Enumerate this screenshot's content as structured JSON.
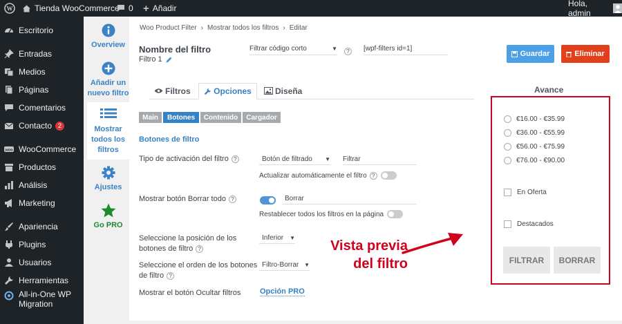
{
  "admin_bar": {
    "site_name": "Tienda WooCommerce",
    "comments_count": "0",
    "new_label": "Añadir",
    "greeting": "Hola, admin"
  },
  "sidebar": {
    "items": [
      {
        "label": "Escritorio",
        "icon": "dashboard-icon"
      },
      {
        "label": "Entradas",
        "icon": "pin-icon"
      },
      {
        "label": "Medios",
        "icon": "media-icon"
      },
      {
        "label": "Páginas",
        "icon": "pages-icon"
      },
      {
        "label": "Comentarios",
        "icon": "comment-icon"
      },
      {
        "label": "Contacto",
        "icon": "mail-icon",
        "badge": "2"
      },
      {
        "label": "WooCommerce",
        "icon": "woo-icon"
      },
      {
        "label": "Productos",
        "icon": "products-icon"
      },
      {
        "label": "Análisis",
        "icon": "chart-icon"
      },
      {
        "label": "Marketing",
        "icon": "megaphone-icon"
      },
      {
        "label": "Apariencia",
        "icon": "brush-icon"
      },
      {
        "label": "Plugins",
        "icon": "plugin-icon"
      },
      {
        "label": "Usuarios",
        "icon": "user-icon"
      },
      {
        "label": "Herramientas",
        "icon": "wrench-icon"
      },
      {
        "label": "All-in-One WP",
        "label2": "Migration",
        "icon": "migration-icon"
      }
    ]
  },
  "plugin_tabs": {
    "overview": "Overview",
    "add_new_1": "Añadir un",
    "add_new_2": "nuevo filtro",
    "show_all_1": "Mostrar",
    "show_all_2": "todos los",
    "show_all_3": "filtros",
    "settings": "Ajustes",
    "go_pro": "Go PRO"
  },
  "breadcrumb": {
    "item1": "Woo Product Filter",
    "item2": "Mostrar todos los filtros",
    "item3": "Editar"
  },
  "filter": {
    "name_label": "Nombre del filtro",
    "name_value": "Filtro 1",
    "shortcode_select": "Filtrar código corto",
    "shortcode_value": "[wpf-filters id=1]",
    "save_label": "Guardar",
    "delete_label": "Eliminar"
  },
  "tabs": {
    "filters": "Filtros",
    "options": "Opciones",
    "design": "Diseña"
  },
  "subtabs": {
    "main": "Main",
    "buttons": "Botones",
    "content": "Contenido",
    "loader": "Cargador"
  },
  "section_title": "Botones de filtro",
  "settings": {
    "activation_label": "Tipo de activación del filtro",
    "activation_select": "Botón de filtrado",
    "activation_text": "Filtrar",
    "auto_update_label": "Actualizar automáticamente el filtro",
    "show_clear_label": "Mostrar botón Borrar todo",
    "clear_text": "Borrar",
    "reset_label": "Restablecer todos los filtros en la página",
    "position_label_1": "Seleccione la posición de los",
    "position_label_2": "botones de filtro",
    "position_select": "Inferior",
    "order_label_1": "Seleccione el orden de los botones",
    "order_label_2": "de filtro",
    "order_select": "Filtro-Borrar",
    "hide_label": "Mostrar el botón Ocultar filtros",
    "hide_value": "Opción PRO"
  },
  "annotation": {
    "line1": "Vista previa",
    "line2": "del filtro"
  },
  "preview": {
    "title": "Avance",
    "price_ranges": [
      "€16.00 - €35.99",
      "€36.00 - €55.99",
      "€56.00 - €75.99",
      "€76.00 - €90.00"
    ],
    "on_sale": "En Oferta",
    "featured": "Destacados",
    "filter_button": "FILTRAR",
    "clear_button": "BORRAR"
  },
  "colors": {
    "primary": "#4f94d4",
    "save": "#4ba0e8",
    "delete": "#e2401c",
    "annotation": "#d0021b",
    "admin_bg": "#1d2327"
  }
}
